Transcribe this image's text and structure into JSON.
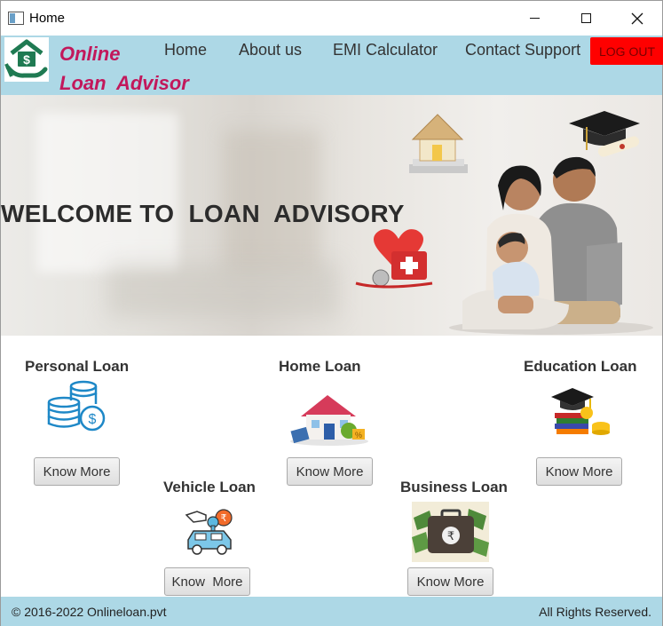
{
  "window": {
    "title": "Home"
  },
  "brand": {
    "line1": "Online",
    "line2": "Loan  Advisor"
  },
  "nav": {
    "links": [
      "Home",
      "About us",
      "EMI Calculator",
      "Contact Support"
    ],
    "logout": "LOG OUT"
  },
  "hero": {
    "title": "WELCOME TO  LOAN  ADVISORY"
  },
  "loans": [
    {
      "title": "Personal Loan",
      "button": "Know More",
      "icon": "coins-dollar-icon"
    },
    {
      "title": "Home Loan",
      "button": "Know More",
      "icon": "house-icon"
    },
    {
      "title": "Education Loan",
      "button": "Know More",
      "icon": "graduation-books-icon"
    },
    {
      "title": "Vehicle Loan",
      "button": "Know  More",
      "icon": "car-key-icon"
    },
    {
      "title": "Business Loan",
      "button": "Know More",
      "icon": "rupee-briefcase-icon"
    }
  ],
  "footer": {
    "copyright": "© 2016-2022 Onlineloan.pvt",
    "rights": "All Rights Reserved."
  },
  "colors": {
    "nav_bg": "#add8e6",
    "brand": "#c2185b",
    "logout_bg": "#ff0000"
  }
}
